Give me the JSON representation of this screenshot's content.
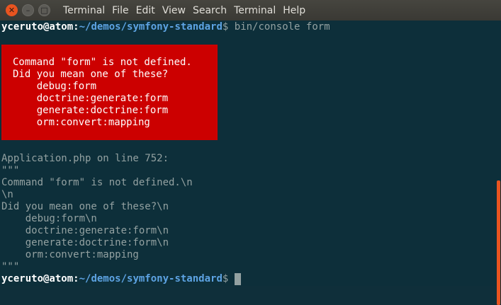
{
  "window": {
    "title": "Terminal",
    "menu": [
      "Terminal",
      "File",
      "Edit",
      "View",
      "Search",
      "Terminal",
      "Help"
    ]
  },
  "prompt": {
    "user": "yceruto@atom",
    "sep": ":",
    "path": "~/demos/symfony-standard",
    "symbol": "$",
    "command": "bin/console form"
  },
  "error_box": {
    "lines": [
      "Command \"form\" is not defined.",
      "Did you mean one of these?",
      "    debug:form",
      "    doctrine:generate:form",
      "    generate:doctrine:form",
      "    orm:convert:mapping"
    ]
  },
  "output": [
    "Application.php on line 752:",
    "\"\"\"",
    "Command \"form\" is not defined.\\n",
    "\\n",
    "Did you mean one of these?\\n",
    "    debug:form\\n",
    "    doctrine:generate:form\\n",
    "    generate:doctrine:form\\n",
    "    orm:convert:mapping",
    "\"\"\""
  ],
  "colors": {
    "background": "#0d2f3a",
    "error_background": "#cc0000",
    "prompt_path": "#5da3e3",
    "accent": "#e95420"
  }
}
